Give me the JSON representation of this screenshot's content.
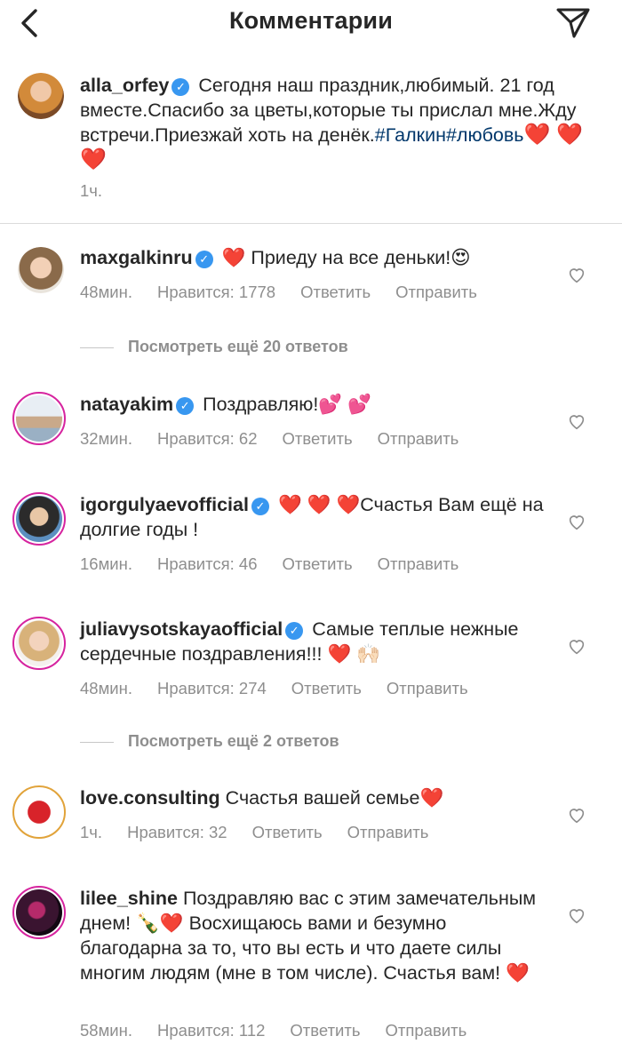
{
  "header": {
    "title": "Комментарии"
  },
  "caption": {
    "username": "alla_orfey",
    "text_before_tag": " Сегодня наш праздник,любимый.  21 год вместе.Спасибо за цветы,которые ты прислал мне.Жду встречи.Приезжай хоть на денёк.",
    "hashtags": "#Галкин#любовь",
    "emoji_tail": "❤️ ❤️ ❤️",
    "time": "1ч."
  },
  "labels": {
    "likes_prefix": "Нравится: ",
    "reply": "Ответить",
    "send": "Отправить"
  },
  "comments": [
    {
      "username": "maxgalkinru",
      "verified": true,
      "text": "❤️ Приеду на все деньки!😍",
      "time": "48мин.",
      "likes": "1778",
      "more_replies": "Посмотреть ещё 20 ответов"
    },
    {
      "username": "natayakim",
      "verified": true,
      "text": "Поздравляю!💕 💕",
      "time": "32мин.",
      "likes": "62"
    },
    {
      "username": "igorgulyaevofficial",
      "verified": true,
      "text": "❤️ ❤️ ❤️Счастья Вам ещё на долгие годы !",
      "time": "16мин.",
      "likes": "46"
    },
    {
      "username": "juliavysotskayaofficial",
      "verified": true,
      "text": "Самые теплые нежные сердечные поздравления!!! ❤️ 🙌🏻",
      "time": "48мин.",
      "likes": "274",
      "more_replies": "Посмотреть ещё 2 ответов"
    },
    {
      "username": "love.consulting",
      "verified": false,
      "text": "Счастья вашей семье❤️",
      "time": "1ч.",
      "likes": "32"
    },
    {
      "username": "lilee_shine",
      "verified": false,
      "text": "Поздравляю вас с этим замечательным днем! 🍾❤️ Восхищаюсь вами и безумно благодарна за то, что вы есть и что даете силы многим людям (мне в том числе). Счастья вам! ❤️",
      "time": "58мин.",
      "likes": "112"
    }
  ],
  "colors": {
    "accent_blue": "#3897f0",
    "heart_red": "#ed1c24",
    "hashtag": "#00376b",
    "muted_text": "#8e8e8e"
  }
}
